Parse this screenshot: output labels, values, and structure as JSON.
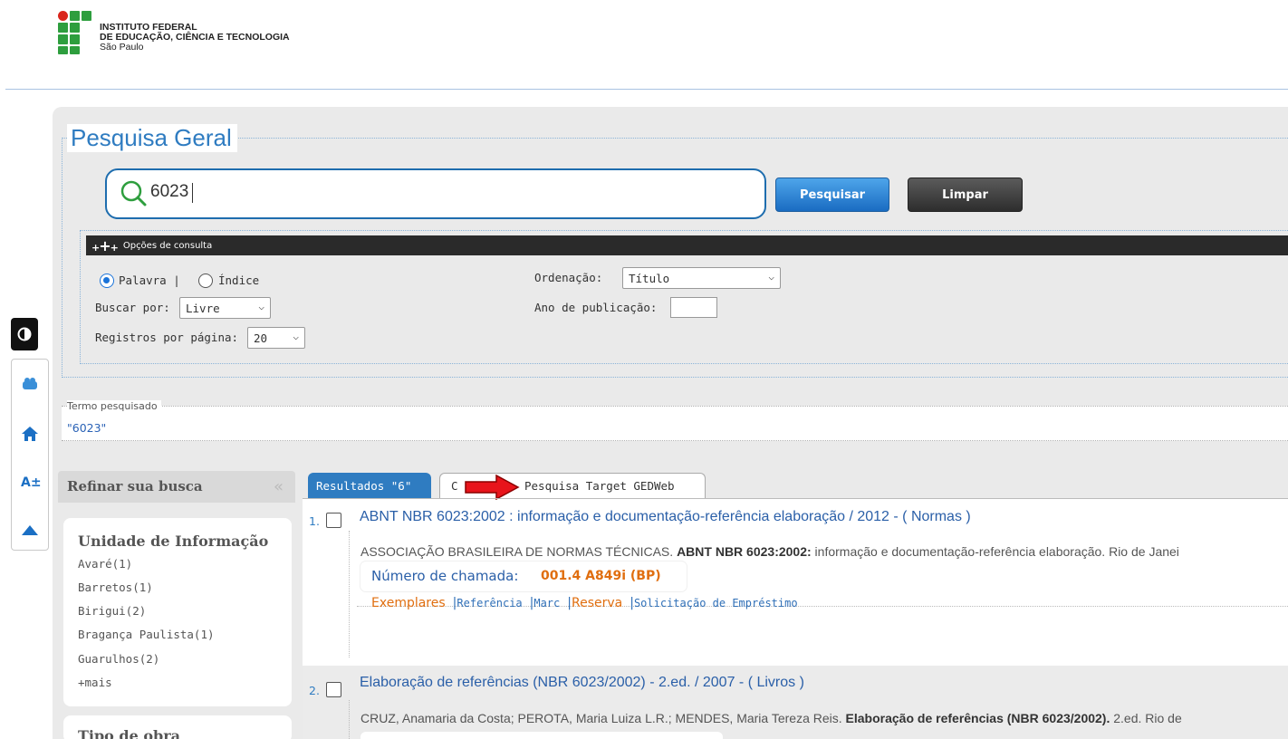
{
  "header": {
    "org_line1": "INSTITUTO FEDERAL",
    "org_line2": "DE EDUCAÇÃO, CIÊNCIA E TECNOLOGIA",
    "org_line3": "São Paulo"
  },
  "search": {
    "title": "Pesquisa Geral",
    "value": "6023",
    "submit_label": "Pesquisar",
    "clear_label": "Limpar"
  },
  "options": {
    "header_label": "Opções de consulta",
    "radio_palavra": "Palavra |",
    "radio_indice": "Índice",
    "buscar_por_label": "Buscar por:",
    "buscar_por_value": "Livre",
    "registros_label": "Registros por página:",
    "registros_value": "20",
    "ordenacao_label": "Ordenação:",
    "ordenacao_value": "Título",
    "ano_label": "Ano de publicação:",
    "ano_value": ""
  },
  "termo": {
    "label": "Termo pesquisado",
    "value": "\"6023\""
  },
  "refine": {
    "title": "Refinar sua busca",
    "unidade_title": "Unidade de Informação",
    "unidades": [
      "Avaré(1)",
      "Barretos(1)",
      "Birigui(2)",
      "Bragança Paulista(1)",
      "Guarulhos(2)",
      "+mais"
    ],
    "tipo_title": "Tipo de obra"
  },
  "tabs": {
    "results_label": "Resultados \"6\"",
    "hidden_tab_initial": "C",
    "target_label": "Pesquisa Target GEDWeb"
  },
  "results": [
    {
      "num": "1.",
      "title": "ABNT NBR 6023:2002 : informação e documentação-referência elaboração / 2012 - ( Normas )",
      "desc_author": "ASSOCIAÇÃO BRASILEIRA DE NORMAS TÉCNICAS. ",
      "desc_bold": "ABNT NBR 6023:2002:",
      "desc_rest": " informação e documentação-referência elaboração. Rio de Janei",
      "chamada_label": "Número de chamada:",
      "chamada_value": "001.4 A849i (BP)",
      "links": {
        "exemplares": "Exemplares",
        "referencia": "Referência",
        "marc": "Marc",
        "reserva": "Reserva",
        "emprestimo": "Solicitação de Empréstimo"
      }
    },
    {
      "num": "2.",
      "title": "Elaboração de referências (NBR 6023/2002) - 2.ed. / 2007 - ( Livros )",
      "desc_author": "CRUZ, Anamaria da Costa; PEROTA, Maria Luiza L.R.; MENDES, Maria Tereza Reis. ",
      "desc_bold": "Elaboração de referências (NBR 6023/2002).",
      "desc_rest": " 2.ed. Rio de"
    }
  ],
  "colors": {
    "accent": "#2f7cc1",
    "orange": "#e06e0f",
    "logo_green": "#2e9e3e",
    "logo_red": "#d9261c"
  }
}
